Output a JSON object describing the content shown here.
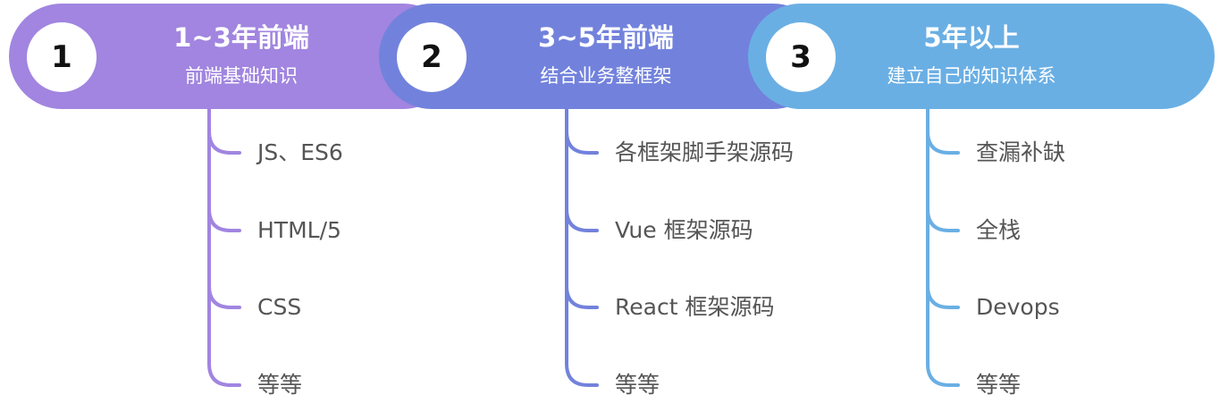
{
  "colors": {
    "stage1": "#a185e0",
    "stage2": "#7282dc",
    "stage3": "#6aafe4",
    "item_text": "#555555"
  },
  "stages": [
    {
      "number": "1",
      "title": "1~3年前端",
      "subtitle": "前端基础知识",
      "items": [
        "JS、ES6",
        "HTML/5",
        "CSS",
        "等等"
      ]
    },
    {
      "number": "2",
      "title": "3~5年前端",
      "subtitle": "结合业务整框架",
      "items": [
        "各框架脚手架源码",
        "Vue 框架源码",
        "React 框架源码",
        "等等"
      ]
    },
    {
      "number": "3",
      "title": "5年以上",
      "subtitle": "建立自己的知识体系",
      "items": [
        "查漏补缺",
        "全栈",
        " Devops",
        "等等"
      ]
    }
  ]
}
